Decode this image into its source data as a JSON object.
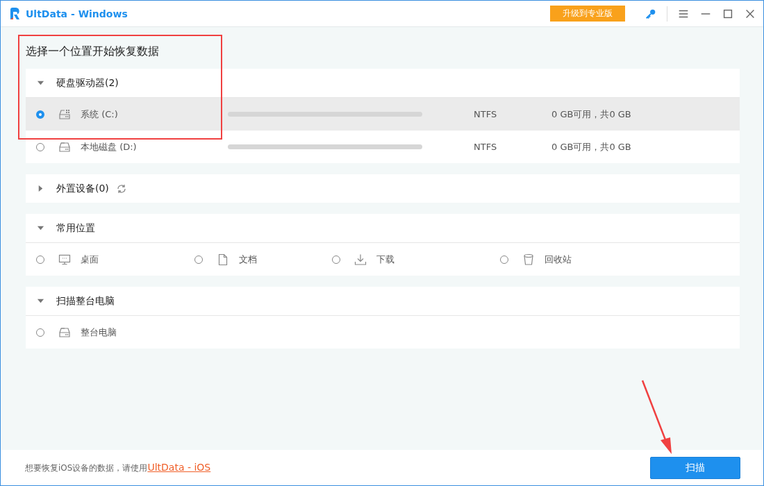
{
  "window": {
    "title": "UltData - Windows",
    "upgrade_button": "升级到专业版"
  },
  "heading": "选择一个位置开始恢复数据",
  "sections": [
    {
      "kind": "drives",
      "title": "硬盘驱动器(2)",
      "expanded": true,
      "items": [
        {
          "kind": "system-drive",
          "name": "系统 (C:)",
          "selected": true,
          "filesystem": "NTFS",
          "capacity": "0 GB可用，共0 GB"
        },
        {
          "kind": "drive",
          "name": "本地磁盘 (D:)",
          "selected": false,
          "filesystem": "NTFS",
          "capacity": "0 GB可用，共0 GB"
        }
      ]
    },
    {
      "kind": "external",
      "title": "外置设备(0)",
      "expanded": false
    },
    {
      "kind": "locations",
      "title": "常用位置",
      "expanded": true,
      "items": [
        {
          "kind": "desktop",
          "name": "桌面",
          "selected": false
        },
        {
          "kind": "document",
          "name": "文档",
          "selected": false
        },
        {
          "kind": "download",
          "name": "下载",
          "selected": false
        },
        {
          "kind": "bin",
          "name": "回收站",
          "selected": false
        }
      ]
    },
    {
      "kind": "drives",
      "title": "扫描整台电脑",
      "expanded": true,
      "items": [
        {
          "kind": "drive",
          "name": "整台电脑",
          "selected": false
        }
      ]
    }
  ],
  "footer": {
    "note": "想要恢复iOS设备的数据，请使用",
    "link": "UltData - iOS",
    "scan_button": "扫描"
  }
}
